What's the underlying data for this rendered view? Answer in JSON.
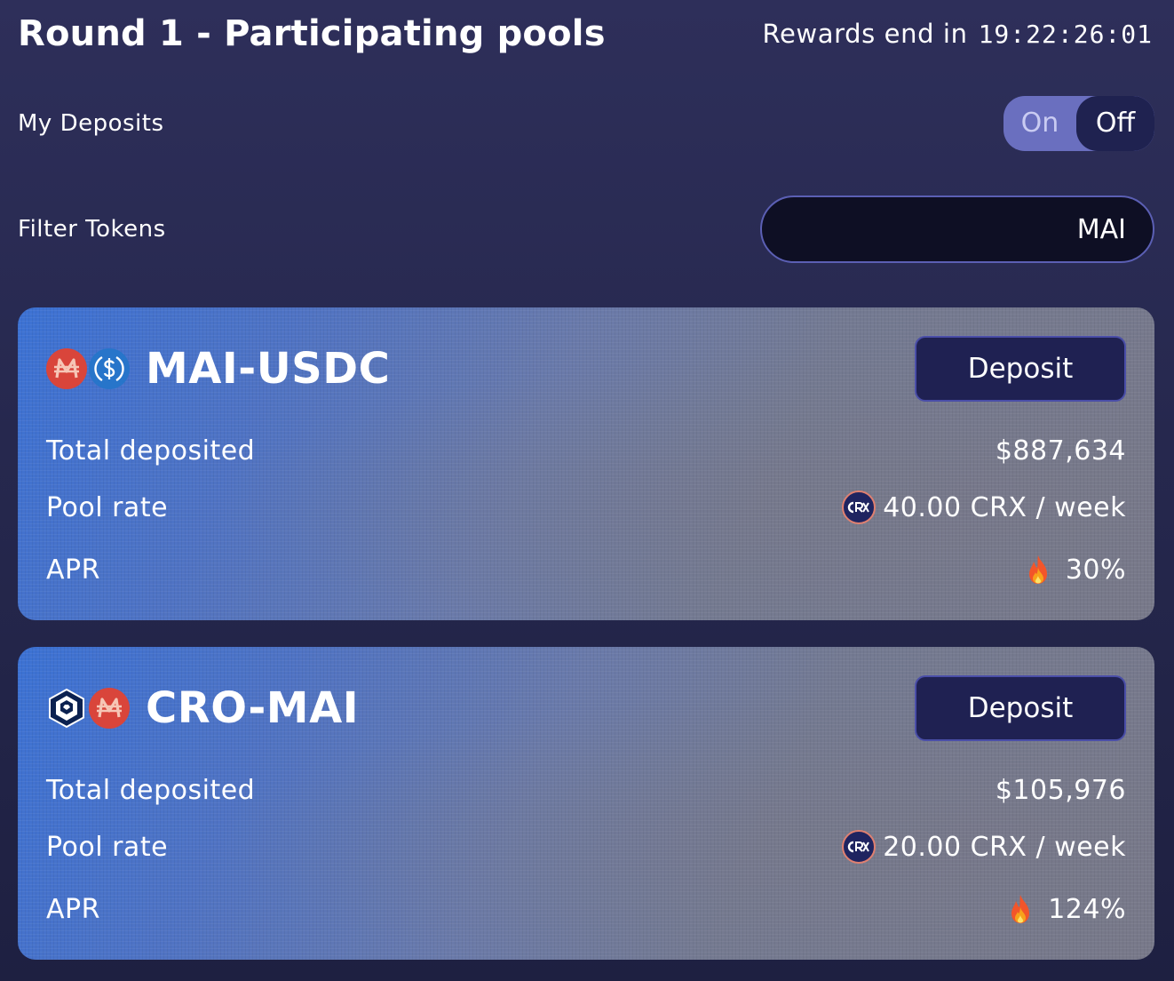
{
  "header": {
    "title": "Round 1 - Participating pools",
    "rewards_label": "Rewards end in",
    "countdown": "19:22:26:01"
  },
  "my_deposits": {
    "label": "My Deposits",
    "toggle_on": "On",
    "toggle_off": "Off",
    "selected": "Off"
  },
  "filter": {
    "label": "Filter Tokens",
    "value": "MAI"
  },
  "pools": [
    {
      "name": "MAI-USDC",
      "tokens": [
        "mai-icon",
        "usdc-icon"
      ],
      "deposit_label": "Deposit",
      "total_deposited_label": "Total deposited",
      "total_deposited": "$887,634",
      "pool_rate_label": "Pool rate",
      "pool_rate": "40.00 CRX / week",
      "apr_label": "APR",
      "apr": "30%"
    },
    {
      "name": "CRO-MAI",
      "tokens": [
        "cro-icon",
        "mai-icon"
      ],
      "deposit_label": "Deposit",
      "total_deposited_label": "Total deposited",
      "total_deposited": "$105,976",
      "pool_rate_label": "Pool rate",
      "pool_rate": "20.00 CRX / week",
      "apr_label": "APR",
      "apr": "124%"
    }
  ],
  "colors": {
    "background": "#2a2b55",
    "toggle_track": "#6a6fbf",
    "toggle_active": "#1f2250",
    "button_bg": "#1f2152",
    "mai_red": "#d9453b",
    "usdc_blue": "#2775ca"
  }
}
